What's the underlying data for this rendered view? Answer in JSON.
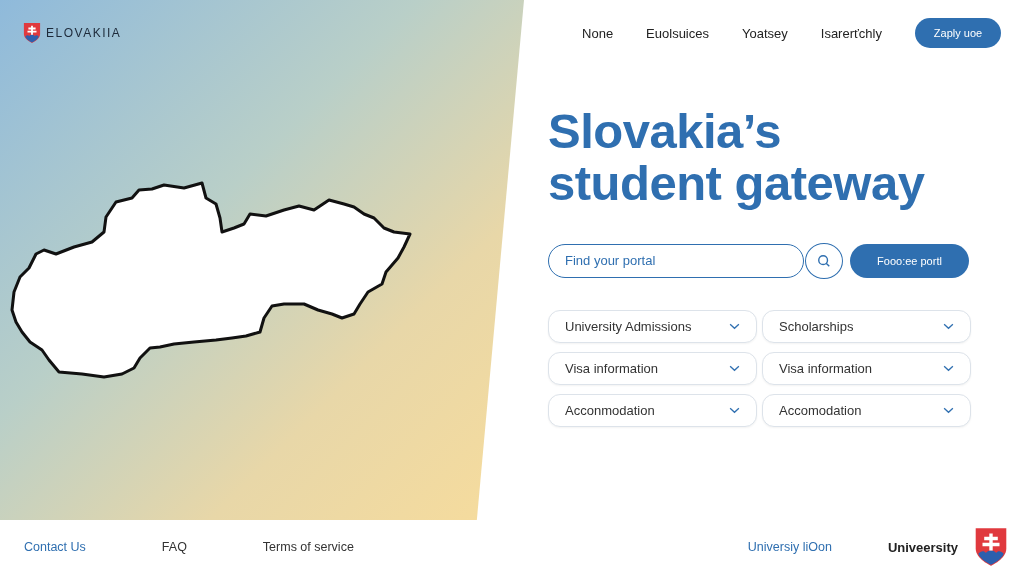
{
  "brand": {
    "name": "ELOVAKIIA"
  },
  "nav": {
    "links": [
      "None",
      "Euolsuices",
      "Yoatsey",
      "Isarerťchly"
    ],
    "button": "Zaply uoe"
  },
  "hero": {
    "title_lines": [
      "Slovakia’s",
      "student gateway"
    ]
  },
  "search": {
    "placeholder": "Find your portal",
    "button": "Fooo:ee portl"
  },
  "topics": [
    {
      "label": "University Admissions"
    },
    {
      "label": "Scholarships"
    },
    {
      "label": "Visa information"
    },
    {
      "label": "Visa information"
    },
    {
      "label": "Acconmodation"
    },
    {
      "label": "Accomodation"
    }
  ],
  "footer": {
    "links": [
      {
        "label": "Contact Us",
        "kind": "link"
      },
      {
        "label": "FAQ",
        "kind": "plain"
      },
      {
        "label": "Terms of service",
        "kind": "plain"
      }
    ],
    "right_link": "Universiy liOon",
    "brand": "Univeersity"
  }
}
